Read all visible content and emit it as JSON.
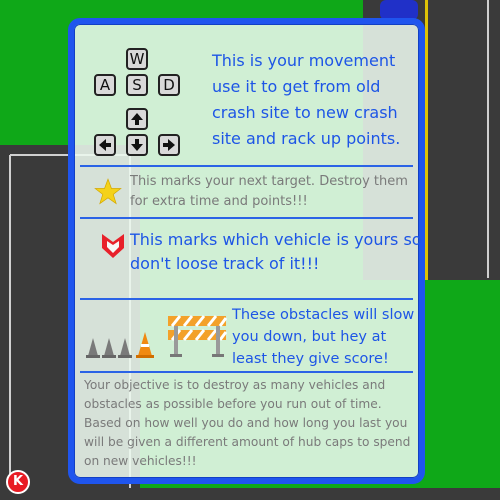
{
  "tutorial": {
    "keys": {
      "up": "W",
      "left": "A",
      "down": "S",
      "right": "D"
    },
    "arrow_keys": [
      "arrow-up-icon",
      "arrow-left-icon",
      "arrow-down-icon",
      "arrow-right-icon"
    ],
    "movement_text": "This is your movement use it to get from old crash site to new crash site and rack up points.",
    "target_text": "This marks your next target. Destroy them for extra time and points!!!",
    "vehicle_text": "This marks which vehicle is yours so don't loose track of it!!!",
    "obstacles_text": "These obstacles will slow you down, but hey at least they give score!",
    "objective_text": "Your objective is to destroy as many vehicles and obstacles as possible before you run out of time. Based on how well you do and how long you last you will be given a different amount of hub caps to spend on new vehicles!!!"
  },
  "hud": {
    "badge_letter": "K"
  },
  "colors": {
    "grass": "#0fa818",
    "road": "#3a3a3a",
    "panel_border": "#1f55ee",
    "text_blue": "#1d55e6",
    "star": "#f4d21a",
    "marker": "#e8202a"
  }
}
